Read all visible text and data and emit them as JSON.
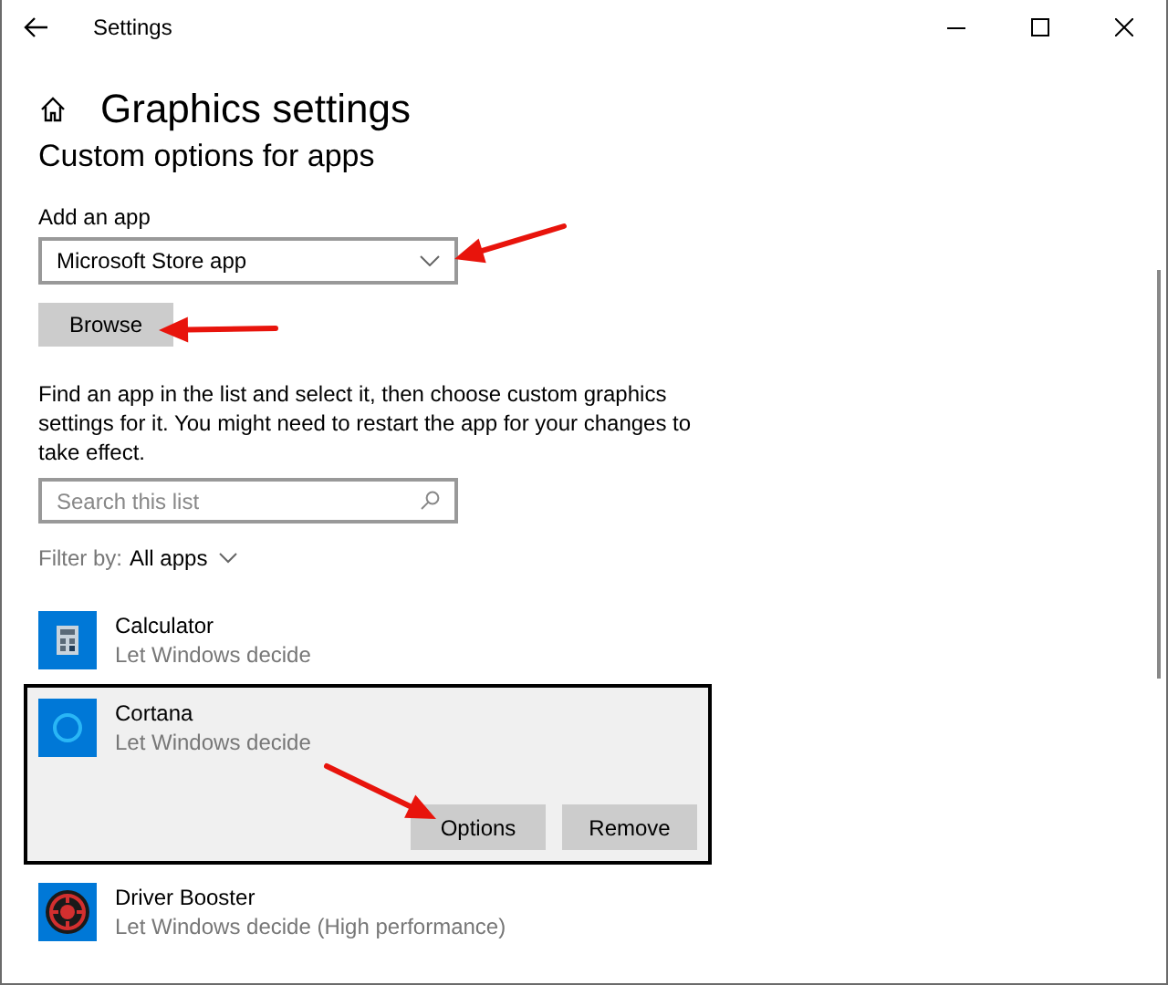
{
  "window": {
    "title": "Settings"
  },
  "page_title": "Graphics settings",
  "section_title": "Custom options for apps",
  "add_app": {
    "label": "Add an app",
    "dropdown_value": "Microsoft Store app",
    "browse_button": "Browse"
  },
  "description": "Find an app in the list and select it, then choose custom graphics settings for it. You might need to restart the app for your changes to take effect.",
  "search": {
    "placeholder": "Search this list"
  },
  "filter": {
    "label": "Filter by:",
    "value": "All apps"
  },
  "apps": [
    {
      "name": "Calculator",
      "status": "Let Windows decide",
      "kind": "calculator",
      "selected": false
    },
    {
      "name": "Cortana",
      "status": "Let Windows decide",
      "kind": "circle",
      "selected": true,
      "buttons": [
        "Options",
        "Remove"
      ]
    },
    {
      "name": "Driver Booster",
      "status": "Let Windows decide (High performance)",
      "kind": "gear",
      "selected": false
    }
  ]
}
